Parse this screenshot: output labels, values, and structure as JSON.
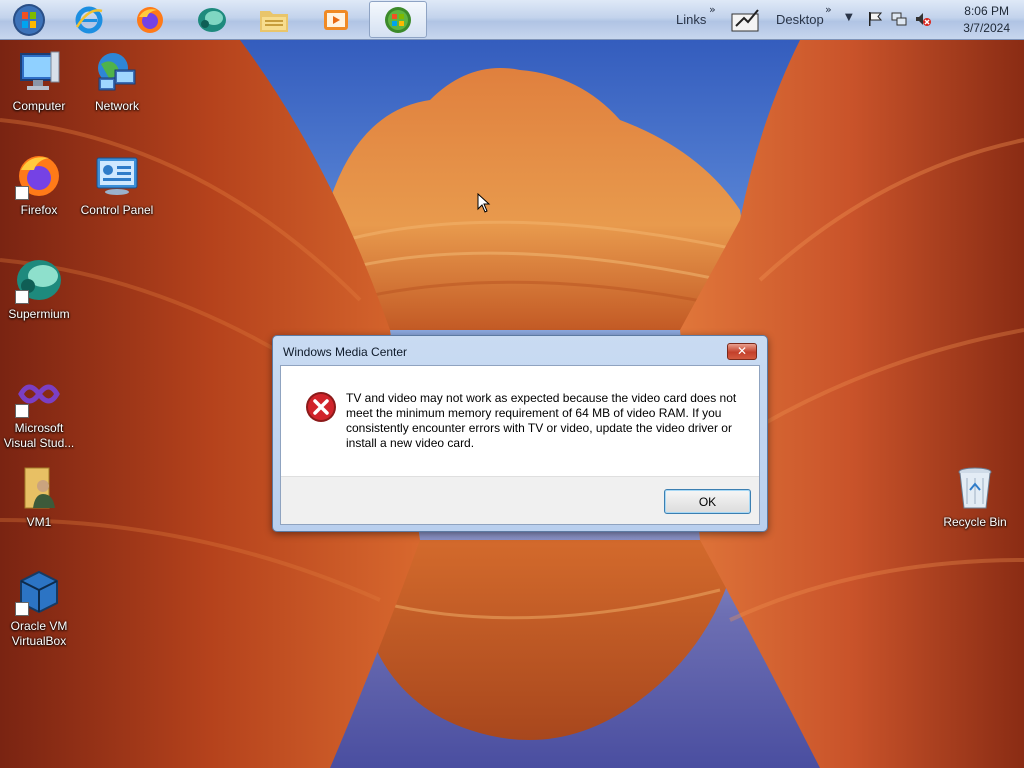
{
  "taskbar": {
    "start": {
      "icon": "windows-orb-icon"
    },
    "pinned": [
      {
        "name": "internet-explorer-icon"
      },
      {
        "name": "firefox-icon"
      },
      {
        "name": "supermium-icon"
      },
      {
        "name": "file-explorer-icon"
      },
      {
        "name": "media-player-icon"
      },
      {
        "name": "windows-media-center-icon"
      }
    ],
    "links_label": "Links",
    "desktop_label": "Desktop",
    "time": "8:06 PM",
    "date": "3/7/2024",
    "tray_icons": [
      "flag-icon",
      "network-icon",
      "volume-muted-icon"
    ]
  },
  "desktop_icons": {
    "computer": "Computer",
    "network": "Network",
    "firefox": "Firefox",
    "control_panel": "Control Panel",
    "supermium": "Supermium",
    "vs_line1": "Microsoft",
    "vs_line2": "Visual Stud...",
    "vm1": "VM1",
    "vbox_line1": "Oracle VM",
    "vbox_line2": "VirtualBox",
    "recycle_bin": "Recycle Bin"
  },
  "dialog": {
    "title": "Windows Media Center",
    "close_label": "✕",
    "icon": "error-icon",
    "message": "TV and video may not work as expected because the video card does not meet the minimum memory requirement of 64 MB of video RAM. If you consistently encounter errors with TV or video, update the video driver or install a new video card.",
    "ok_label": "OK"
  },
  "colors": {
    "taskbar_bg": "#c3d3ec",
    "dialog_frame": "#b9cfee",
    "error_red": "#d1242b",
    "rock_orange": "#d9602a"
  }
}
